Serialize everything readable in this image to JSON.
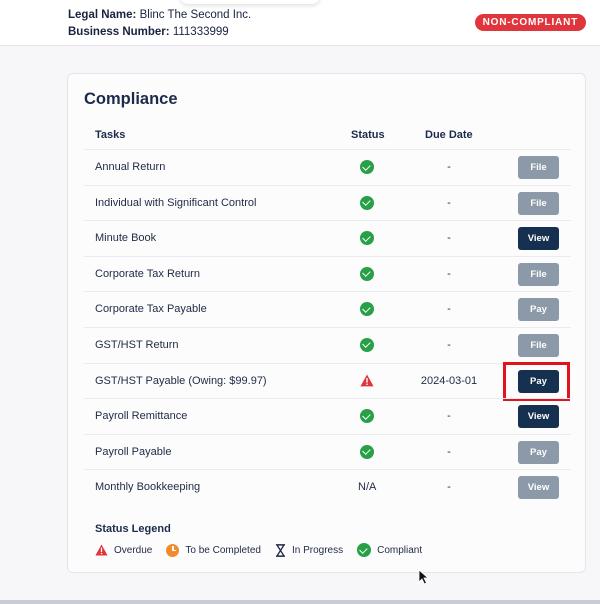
{
  "header": {
    "legal_name_label": "Legal Name:",
    "legal_name_value": "Blinc The Second Inc.",
    "business_number_label": "Business Number:",
    "business_number_value": "111333999",
    "status_badge": "NON-COMPLIANT"
  },
  "compliance": {
    "title": "Compliance",
    "columns": {
      "tasks": "Tasks",
      "status": "Status",
      "due_date": "Due Date"
    },
    "rows": [
      {
        "task": "Annual Return",
        "status": "check-icon",
        "due": "-",
        "action": "File",
        "style": "muted"
      },
      {
        "task": "Individual with Significant Control",
        "status": "check-icon",
        "due": "-",
        "action": "File",
        "style": "muted"
      },
      {
        "task": "Minute Book",
        "status": "check-icon",
        "due": "-",
        "action": "View",
        "style": "dark"
      },
      {
        "task": "Corporate Tax Return",
        "status": "check-icon",
        "due": "-",
        "action": "File",
        "style": "muted"
      },
      {
        "task": "Corporate Tax Payable",
        "status": "check-icon",
        "due": "-",
        "action": "Pay",
        "style": "muted"
      },
      {
        "task": "GST/HST Return",
        "status": "check-icon",
        "due": "-",
        "action": "File",
        "style": "muted"
      },
      {
        "task": "GST/HST Payable (Owing: $99.97)",
        "status": "warning-icon",
        "due": "2024-03-01",
        "action": "Pay",
        "style": "dark",
        "highlighted": true
      },
      {
        "task": "Payroll Remittance",
        "status": "check-icon",
        "due": "-",
        "action": "View",
        "style": "dark"
      },
      {
        "task": "Payroll Payable",
        "status": "check-icon",
        "due": "-",
        "action": "Pay",
        "style": "muted"
      },
      {
        "task": "Monthly Bookkeeping",
        "status_text": "N/A",
        "due": "-",
        "action": "View",
        "style": "muted"
      }
    ],
    "legend": {
      "title": "Status Legend",
      "items": [
        {
          "icon": "warning-icon",
          "label": "Overdue"
        },
        {
          "icon": "clock-icon",
          "label": "To be Completed"
        },
        {
          "icon": "hourglass-icon",
          "label": "In Progress"
        },
        {
          "icon": "check-icon",
          "label": "Compliant"
        }
      ]
    }
  },
  "colors": {
    "compliant": "#27a047",
    "overdue": "#e0353c",
    "to_be_completed": "#f28a2e",
    "button_dark": "#16304f",
    "button_muted": "#8c99a8",
    "highlight": "#e0141c"
  }
}
